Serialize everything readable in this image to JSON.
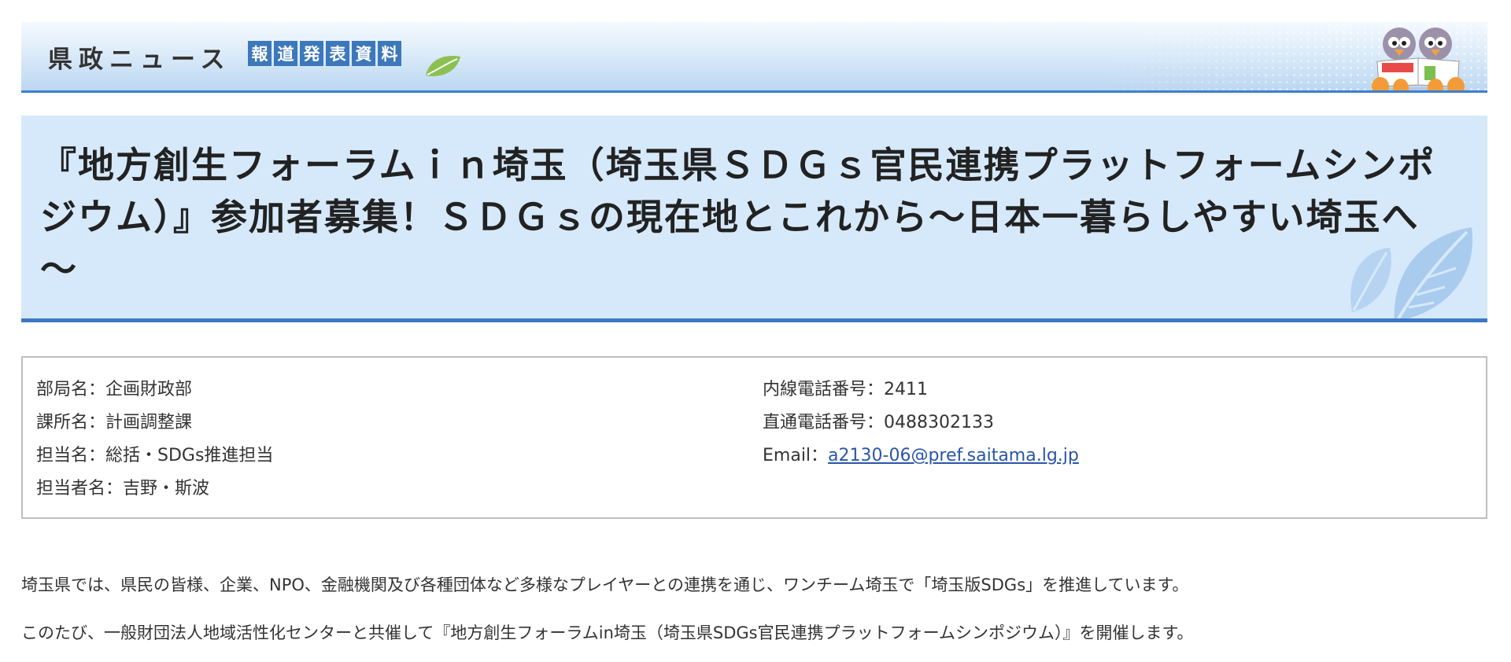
{
  "banner": {
    "title": "県政ニュース",
    "tags": [
      "報",
      "道",
      "発",
      "表",
      "資",
      "料"
    ]
  },
  "headline": {
    "text": "『地方創生フォーラムｉｎ埼玉（埼玉県ＳＤＧｓ官民連携プラットフォームシンポジウム）』参加者募集！ＳＤＧｓの現在地とこれから～日本一暮らしやすい埼玉へ～"
  },
  "contact": {
    "department": "部局名：企画財政部",
    "division": "課所名：計画調整課",
    "section": "担当名：総括・SDGs推進担当",
    "staff": "担当者名：吉野・斯波",
    "extension": "内線電話番号：2411",
    "direct": "直通電話番号：0488302133",
    "email_label": "Email：",
    "email": "a2130-06@pref.saitama.lg.jp"
  },
  "body": {
    "p1": "埼玉県では、県民の皆様、企業、NPO、金融機関及び各種団体など多様なプレイヤーとの連携を通じ、ワンチーム埼玉で「埼玉版SDGs」を推進しています。",
    "p2": "このたび、一般財団法人地域活性化センターと共催して『地方創生フォーラムin埼玉（埼玉県SDGs官民連携プラットフォームシンポジウム）』を開催します。"
  },
  "colors": {
    "banner_accent": "#3d7fd0",
    "tag_bg": "#3d78bb",
    "headline_bg": "#d6e9fb",
    "link": "#2a55a8"
  }
}
